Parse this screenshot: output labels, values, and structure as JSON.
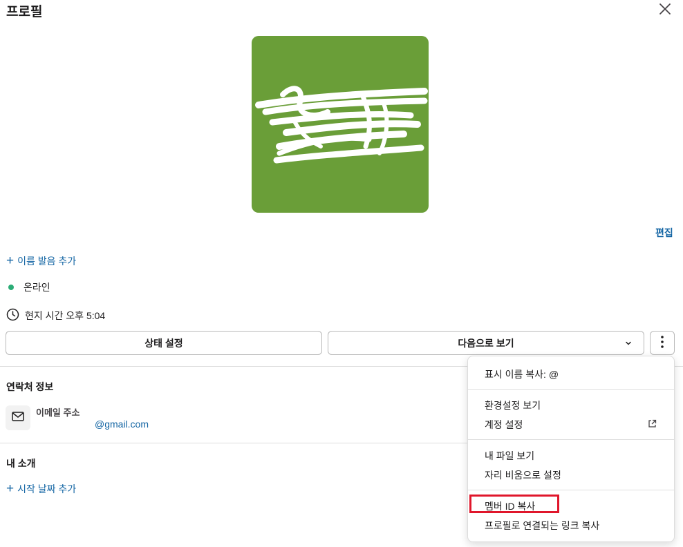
{
  "header": {
    "title": "프로필"
  },
  "profile": {
    "edit_label": "편집",
    "add_pronunciation": "이름 발음 추가",
    "status": "온라인",
    "local_time": "현지 시간 오후 5:04",
    "avatar_color": "#6a9e38"
  },
  "actions": {
    "set_status": "상태 설정",
    "view_as": "다음으로 보기"
  },
  "contact": {
    "section_title": "연락처 정보",
    "email_label": "이메일 주소",
    "email_value": "@gmail.com"
  },
  "about": {
    "section_title": "내 소개",
    "add_start_date": "시작 날짜 추가"
  },
  "menu": {
    "copy_display_name": "표시 이름 복사: @",
    "view_preferences": "환경설정 보기",
    "account_settings": "계정 설정",
    "view_my_files": "내 파일 보기",
    "set_away": "자리 비움으로 설정",
    "copy_member_id": "멤버 ID 복사",
    "copy_profile_link": "프로필로 연결되는 링크 복사"
  },
  "colors": {
    "accent_link": "#1264a3",
    "online": "#2bac76",
    "highlight_border": "#e0162b"
  }
}
